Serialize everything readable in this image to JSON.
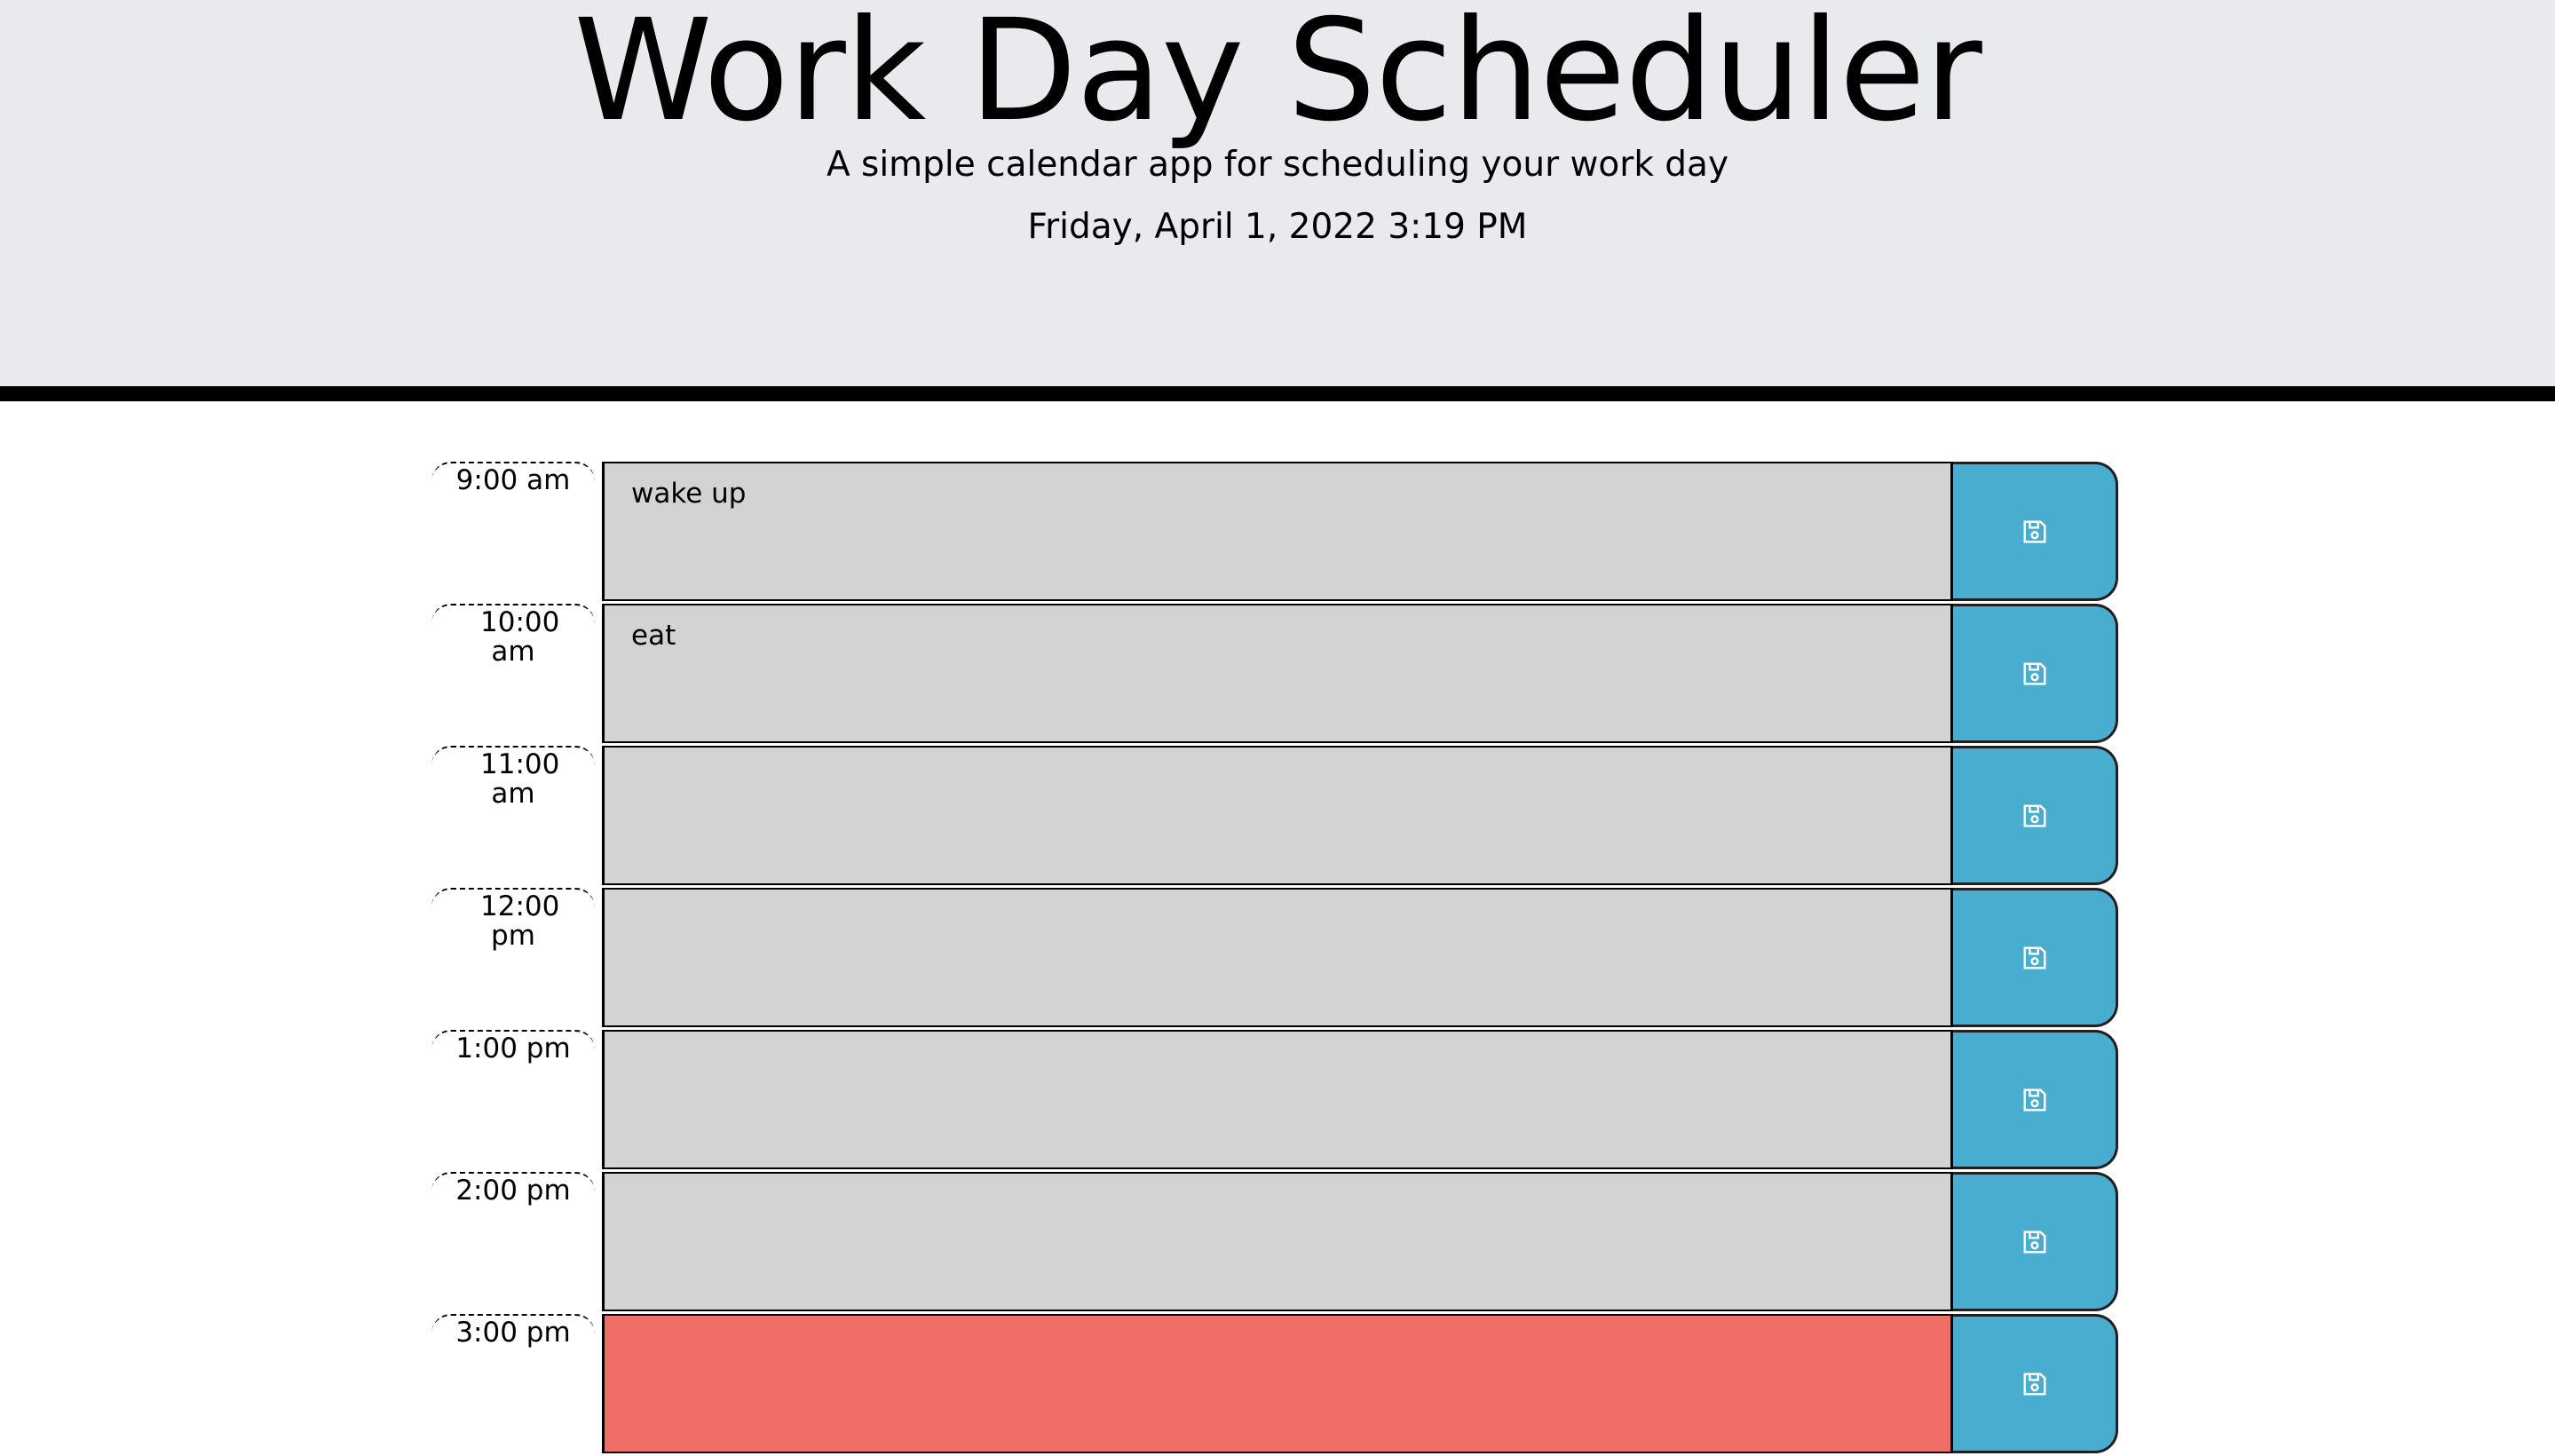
{
  "header": {
    "title": "Work Day Scheduler",
    "subtitle": "A simple calendar app for scheduling your work day",
    "current_datetime": "Friday, April 1, 2022 3:19 PM"
  },
  "colors": {
    "past": "#d3d3d3",
    "present": "#ef6f66",
    "save_button": "#48adcf",
    "header_background": "#e9eaee"
  },
  "save_icon": "floppy-disk-icon",
  "time_blocks": [
    {
      "hour": "9:00 am",
      "text": "wake up",
      "state": "past"
    },
    {
      "hour": "10:00 am",
      "text": "eat",
      "state": "past"
    },
    {
      "hour": "11:00 am",
      "text": "",
      "state": "past"
    },
    {
      "hour": "12:00 pm",
      "text": "",
      "state": "past"
    },
    {
      "hour": "1:00 pm",
      "text": "",
      "state": "past"
    },
    {
      "hour": "2:00 pm",
      "text": "",
      "state": "past"
    },
    {
      "hour": "3:00 pm",
      "text": "",
      "state": "present"
    }
  ]
}
